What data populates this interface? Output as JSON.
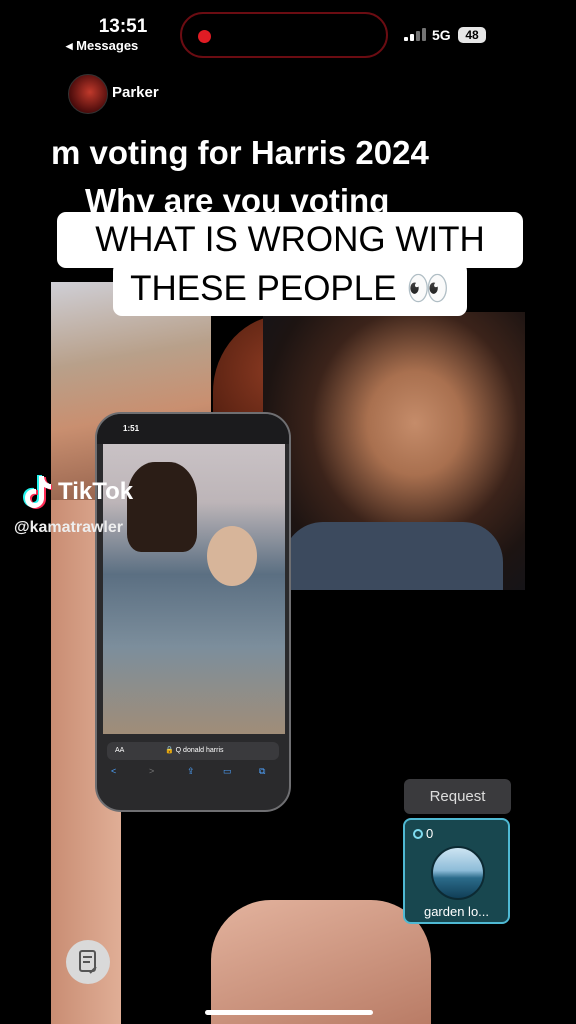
{
  "status_bar": {
    "time": "13:51",
    "back_label": "◂ Messages",
    "network": "5G",
    "battery": "48"
  },
  "header": {
    "username": "Parker"
  },
  "video": {
    "title_line1": "m voting for Harris 2024",
    "title_line2": "Why are you voting",
    "caption_line1": "WHAT IS WRONG WITH",
    "caption_line2": "THESE PEOPLE 👀",
    "watermark": "TikTok",
    "handle": "@kamatrawler"
  },
  "inner_phone": {
    "time": "1:51",
    "url_aa": "AA",
    "url_text": "🔒 Q donald harris"
  },
  "request_button": {
    "label": "Request"
  },
  "music_card": {
    "count": "0",
    "title": "garden lo..."
  }
}
